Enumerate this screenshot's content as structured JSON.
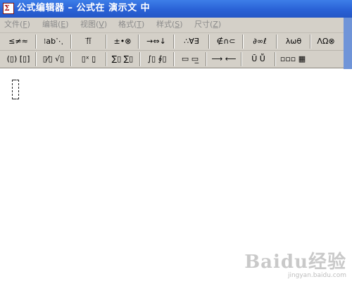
{
  "window": {
    "title": "公式编辑器 – 公式在 演示文 中",
    "app_icon": "equation-editor-icon"
  },
  "menu": [
    {
      "label": "文件",
      "key": "F"
    },
    {
      "label": "编辑",
      "key": "E"
    },
    {
      "label": "视图",
      "key": "V"
    },
    {
      "label": "格式",
      "key": "T"
    },
    {
      "label": "样式",
      "key": "S"
    },
    {
      "label": "尺寸",
      "key": "Z"
    }
  ],
  "toolbar": {
    "row1": [
      {
        "label": "≤≠≈",
        "icon": "relational-symbols-icon"
      },
      {
        "label": "⁝ab⋱",
        "icon": "spaces-ellipses-icon"
      },
      {
        "label": "⁞⃗⁞⃛",
        "icon": "embellishments-icon"
      },
      {
        "label": "±•⊗",
        "icon": "operator-symbols-icon"
      },
      {
        "label": "→⇔↓",
        "icon": "arrow-symbols-icon"
      },
      {
        "label": "∴∀∃",
        "icon": "logical-symbols-icon"
      },
      {
        "label": "∉∩⊂",
        "icon": "set-theory-symbols-icon"
      },
      {
        "label": "∂∞ℓ",
        "icon": "misc-symbols-icon"
      },
      {
        "label": "λωθ",
        "icon": "greek-lowercase-icon"
      },
      {
        "label": "ΛΩ⊗",
        "icon": "greek-uppercase-icon"
      }
    ],
    "row2": [
      {
        "label": "(▯) [▯]",
        "icon": "fence-templates-icon"
      },
      {
        "label": "▯⁄▯ √▯",
        "icon": "fraction-radical-templates-icon"
      },
      {
        "label": "▯ˣ ▯̣",
        "icon": "subscript-superscript-templates-icon"
      },
      {
        "label": "∑▯ ∑▯",
        "icon": "summation-templates-icon"
      },
      {
        "label": "∫▯ ∮▯",
        "icon": "integral-templates-icon"
      },
      {
        "label": "▭ ▭̲",
        "icon": "underbar-overbar-templates-icon"
      },
      {
        "label": "⟶ ⟵",
        "icon": "labeled-arrow-templates-icon"
      },
      {
        "label": "Ū Ṻ",
        "icon": "products-set-theory-templates-icon"
      },
      {
        "label": "▫▫▫ ▦",
        "icon": "matrix-templates-icon"
      }
    ]
  },
  "watermark": {
    "main": "Baidu经验",
    "sub": "jingyan.baidu.com"
  }
}
